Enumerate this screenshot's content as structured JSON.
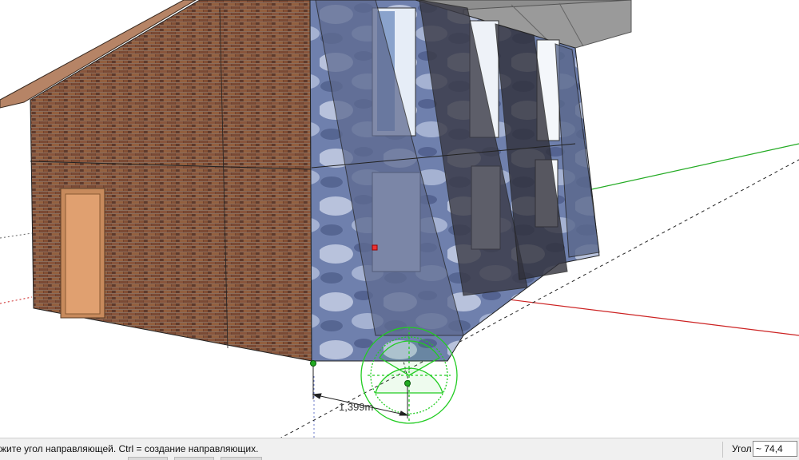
{
  "viewport": {
    "dimension_label": "1,399m"
  },
  "status_bar": {
    "hint_text": "жите угол направляющей.  Ctrl = создание направляющих.",
    "measurements_label": "Угол",
    "measurements_value": "~ 74,4"
  },
  "colors": {
    "axis_red": "#cc2222",
    "axis_green": "#22aa22",
    "protractor": "#22cc22",
    "brick": "#7a4a36",
    "roof": "#a87a60",
    "glass": "#7d8fb6",
    "door": "#d89a6a"
  }
}
